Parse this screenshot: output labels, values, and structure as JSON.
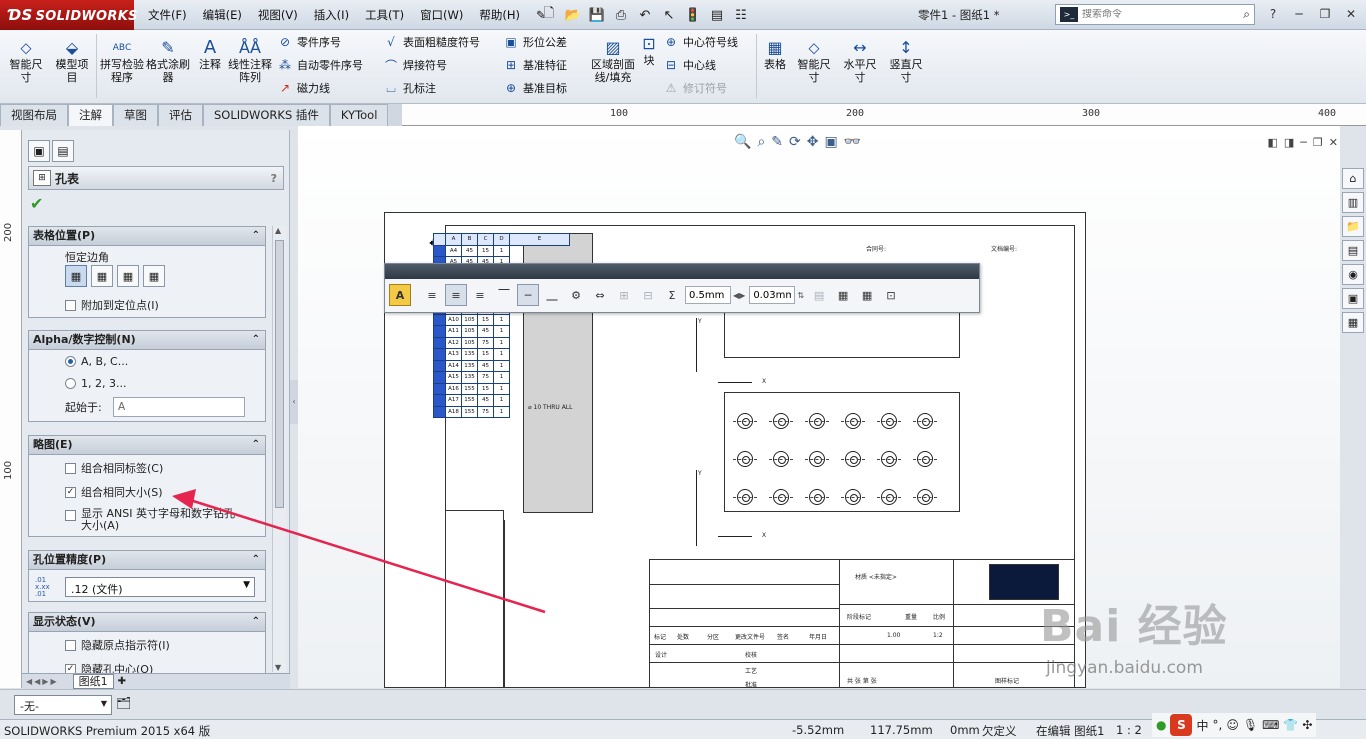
{
  "app": {
    "logo_text": "SOLIDWORKS",
    "doc_title": "零件1 - 图纸1 *"
  },
  "menu": [
    "文件(F)",
    "编辑(E)",
    "视图(V)",
    "插入(I)",
    "工具(T)",
    "窗口(W)",
    "帮助(H)"
  ],
  "search": {
    "placeholder": "搜索命令"
  },
  "ribbon": {
    "smart_dim": "智能尺寸",
    "model_items": "模型项目",
    "spell_check": "拼写检验程序",
    "format_painter": "格式涂刷器",
    "note": "注释",
    "linear_note_pattern": "线性注释阵列",
    "balloon": "零件序号",
    "auto_balloon": "自动零件序号",
    "magnetic_line": "磁力线",
    "surface_finish": "表面粗糙度符号",
    "weld_symbol": "焊接符号",
    "hole_callout": "孔标注",
    "gtol": "形位公差",
    "datum_feature": "基准特征",
    "datum_target": "基准目标",
    "area_hatch": "区域剖面线/填充",
    "block": "块",
    "center_mark": "中心符号线",
    "centerline": "中心线",
    "revision_symbol": "修订符号",
    "tables": "表格",
    "smart_dim2": "智能尺寸",
    "horizontal_dim": "水平尺寸",
    "vertical_dim": "竖直尺寸"
  },
  "tabs": [
    "视图布局",
    "注解",
    "草图",
    "评估",
    "SOLIDWORKS 插件",
    "KYTool"
  ],
  "ruler_top": [
    "100",
    "200",
    "300",
    "400"
  ],
  "ruler_left": [
    "200",
    "100"
  ],
  "property_manager": {
    "title": "孔表",
    "help": "?",
    "table_position": {
      "header": "表格位置(P)",
      "fixed_corner": "恒定边角",
      "attach_anchor": "附加到定位点(I)"
    },
    "alpha_numeric": {
      "header": "Alpha/数字控制(N)",
      "opt_alpha": "A, B, C...",
      "opt_numeric": "1, 2, 3...",
      "start_label": "起始于:",
      "start_value": "A"
    },
    "scheme": {
      "header": "略图(E)",
      "combine_tags": "组合相同标签(C)",
      "combine_sizes": "组合相同大小(S)",
      "show_ansi": "显示 ANSI 英寸字母和数字钻孔大小(A)"
    },
    "hole_precision": {
      "header": "孔位置精度(P)",
      "value": ".12 (文件)"
    },
    "display_state": {
      "header": "显示状态(V)",
      "hide_origin": "隐藏原点指示符(I)",
      "hide_center": "隐藏孔中心(O)"
    }
  },
  "sheet_tab": "图纸1",
  "format_toolbar": {
    "line_height": "0.5mm",
    "margin": "0.03mm"
  },
  "hole_table": {
    "header": [
      "A",
      "B",
      "C",
      "D",
      "E"
    ],
    "rows": [
      [
        "A4",
        "45",
        "15",
        "1"
      ],
      [
        "A5",
        "45",
        "45",
        "1"
      ],
      [
        "A6",
        "45",
        "75",
        "1"
      ],
      [
        "A7",
        "75",
        "15",
        "1"
      ],
      [
        "A8",
        "75",
        "45",
        "1"
      ],
      [
        "A9",
        "75",
        "75",
        "1"
      ],
      [
        "A10",
        "105",
        "15",
        "1"
      ],
      [
        "A11",
        "105",
        "45",
        "1"
      ],
      [
        "A12",
        "105",
        "75",
        "1"
      ],
      [
        "A13",
        "135",
        "15",
        "1"
      ],
      [
        "A14",
        "135",
        "45",
        "1"
      ],
      [
        "A15",
        "135",
        "75",
        "1"
      ],
      [
        "A16",
        "155",
        "15",
        "1"
      ],
      [
        "A17",
        "155",
        "45",
        "1"
      ],
      [
        "A18",
        "155",
        "75",
        "1"
      ]
    ]
  },
  "drawing": {
    "contract_no": "合同号:",
    "doc_no": "文档编号:",
    "material": "材质 <未指定>",
    "scale": "1:2",
    "mass": "1.00",
    "title_labels": [
      "标记",
      "处数",
      "分区",
      "更改文件号",
      "签名",
      "年月日"
    ],
    "design": "设计",
    "check": "校核",
    "process": "工艺",
    "approve": "批准",
    "stage_mark": "阶段标记",
    "weight": "重量",
    "ratio": "比例",
    "sheet_of": "共 张 第 张",
    "ident": "图样标记"
  },
  "layer": {
    "value": "-无-"
  },
  "status": {
    "product": "SOLIDWORKS Premium 2015 x64 版",
    "x": "-5.52mm",
    "y": "117.75mm",
    "z": "0mm",
    "state": "欠定义",
    "editing": "在编辑 图纸1",
    "scale": "1 : 2"
  },
  "ime": {
    "logo": "S",
    "lang": "中"
  },
  "watermark": {
    "brand": "Bai 经验",
    "url": "jingyan.baidu.com"
  }
}
